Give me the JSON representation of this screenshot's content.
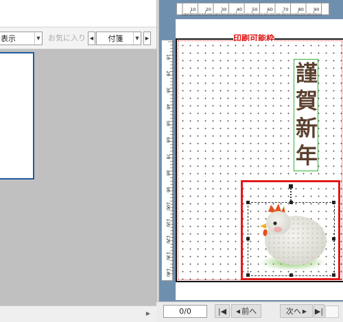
{
  "left_toolbar": {
    "display_combo": "表示",
    "favorites_label": "お気に入り",
    "sticky_combo": "付箋"
  },
  "ruler": {
    "h_ticks": [
      "10",
      "20",
      "30",
      "40",
      "50",
      "60",
      "70",
      "80",
      "90"
    ],
    "v_ticks": [
      "10",
      "20",
      "30",
      "40",
      "50",
      "60",
      "70",
      "80",
      "90",
      "100",
      "110",
      "120",
      "130",
      "140"
    ]
  },
  "canvas": {
    "printable_label": "印刷可能枠",
    "greeting_chars": [
      "謹",
      "賀",
      "新",
      "年"
    ]
  },
  "status_bar": {
    "page_counter": "0/0",
    "prev_label": "前へ",
    "next_label": "次へ"
  },
  "colors": {
    "accent_blue": "#1e5aa0",
    "selection_red": "#e01818",
    "greeting_brown": "#5b4130",
    "frame_green": "#33b033"
  },
  "icons": [
    "chevron-down-icon",
    "chevron-left-icon",
    "chevron-right-icon",
    "first-page-icon",
    "last-page-icon",
    "rooster-illustration"
  ]
}
